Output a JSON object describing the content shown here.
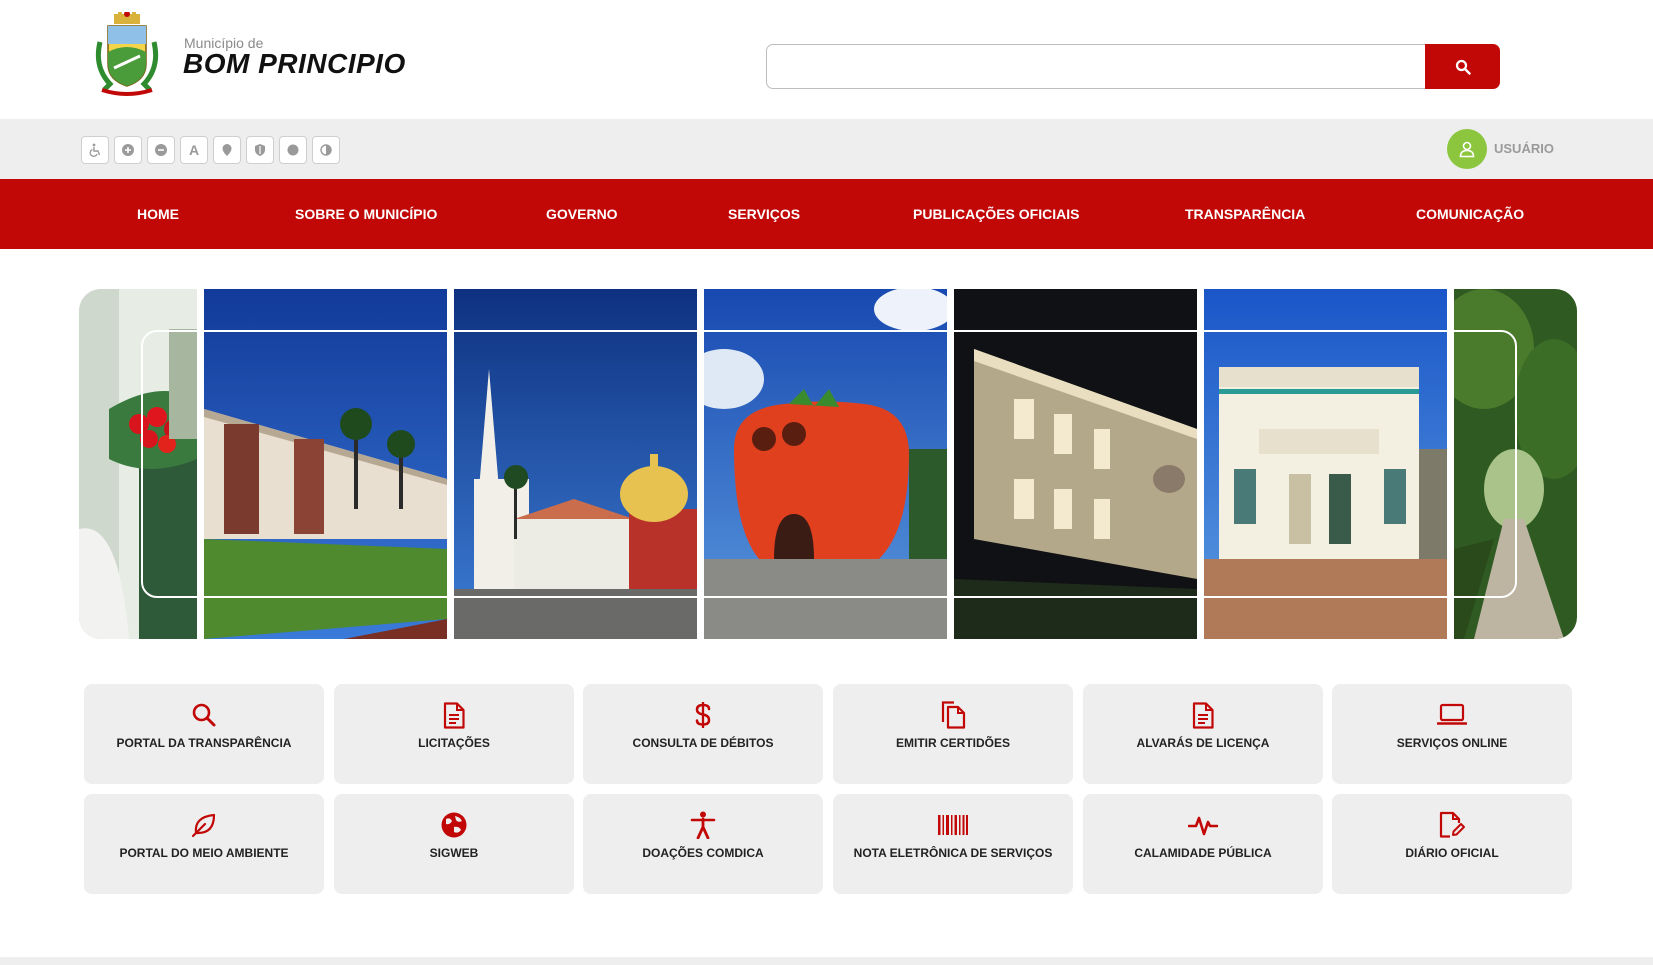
{
  "header": {
    "brand_small": "Município de",
    "brand_big": "BOM PRINCIPIO",
    "search_value": "",
    "search_button_icon": "search-icon"
  },
  "accessibility": {
    "buttons": [
      "wheelchair-icon",
      "zoom-in-icon",
      "zoom-out-icon",
      "A",
      "location-icon",
      "shield-icon",
      "dot-icon",
      "contrast-icon"
    ]
  },
  "user": {
    "label": "USUÁRIO"
  },
  "nav": {
    "items": [
      "HOME",
      "SOBRE O MUNICÍPIO",
      "GOVERNO",
      "SERVIÇOS",
      "PUBLICAÇÕES OFICIAIS",
      "TRANSPARÊNCIA",
      "COMUNICAÇÃO"
    ]
  },
  "tiles": [
    {
      "label": "PORTAL DA TRANSPARÊNCIA",
      "icon": "search-icon"
    },
    {
      "label": "LICITAÇÕES",
      "icon": "document-icon"
    },
    {
      "label": "CONSULTA DE DÉBITOS",
      "icon": "dollar-icon"
    },
    {
      "label": "EMITIR CERTIDÕES",
      "icon": "copy-icon"
    },
    {
      "label": "ALVARÁS DE LICENÇA",
      "icon": "document-icon"
    },
    {
      "label": "SERVIÇOS ONLINE",
      "icon": "laptop-icon"
    },
    {
      "label": "PORTAL DO MEIO AMBIENTE",
      "icon": "leaf-icon"
    },
    {
      "label": "SIGWEB",
      "icon": "globe-icon"
    },
    {
      "label": "DOAÇÕES COMDICA",
      "icon": "person-icon"
    },
    {
      "label": "NOTA ELETRÔNICA DE SERVIÇOS",
      "icon": "barcode-icon"
    },
    {
      "label": "CALAMIDADE PÚBLICA",
      "icon": "pulse-icon"
    },
    {
      "label": "DIÁRIO OFICIAL",
      "icon": "edit-document-icon"
    }
  ],
  "colors": {
    "brand_red": "#c10807",
    "tile_bg": "#eeeeee",
    "user_green": "#8cc63f"
  }
}
